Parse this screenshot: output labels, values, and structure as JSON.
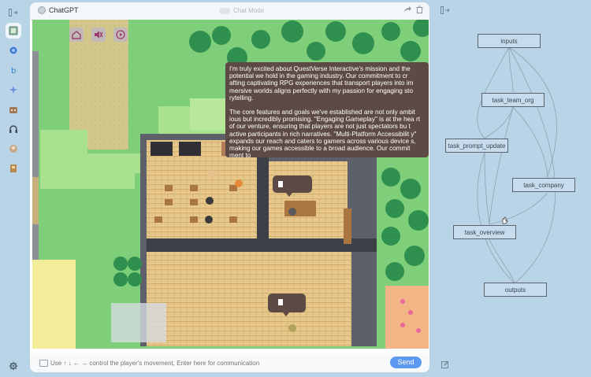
{
  "left_rail": {
    "top_icon": "sidebar-expand-icon",
    "items": [
      {
        "icon": "notebook-icon",
        "active": true
      },
      {
        "icon": "app-icon-blue"
      },
      {
        "icon": "bing-icon"
      },
      {
        "icon": "sparkle-icon"
      },
      {
        "icon": "sloth-icon"
      },
      {
        "icon": "headphones-icon"
      },
      {
        "icon": "avatar-icon"
      },
      {
        "icon": "badge-icon"
      }
    ],
    "bottom_icon": "settings-icon"
  },
  "chat": {
    "title": "ChatGPT",
    "mode_label": "Chat Mode",
    "input_placeholder": "Use ↑ ↓ ← → control the player's movement, Enter here for communication",
    "send_label": "Send"
  },
  "game": {
    "toolbar_icons": [
      "home-icon",
      "mute-icon",
      "play-icon"
    ],
    "speech_paragraphs": [
      "I'm truly excited about QuestVerse Interactive's mission and the potential we hold in the gaming industry. Our commitment to cr afting captivating RPG experiences that transport players into im mersive worlds aligns perfectly with my passion for engaging sto rytelling.",
      "The core features and goals we've established are not only ambit ious but incredibly promising. \"Engaging Gameplay\" is at the hea rt of our venture, ensuring that players are not just spectators bu t active participants in rich narratives. \"Multi-Platform Accessibilit y\" expands our reach and caters to gamers across various device s, making our games accessible to a broad audience. Our commit ment to"
    ]
  },
  "flow": {
    "nodes": {
      "inputs": "inputs",
      "task_team_org": "task_team_org",
      "task_prompt_update": "task_prompt_update",
      "task_company": "task_company",
      "task_overview": "task_overview",
      "outputs": "outputs"
    },
    "top_icon": "sidebar-expand-icon",
    "bottom_icon": "edit-icon"
  },
  "colors": {
    "background": "#b9d4e6",
    "grass": "#7fcf7a",
    "speech_bubble": "#5d4a44",
    "send_button": "#5b9af0"
  }
}
